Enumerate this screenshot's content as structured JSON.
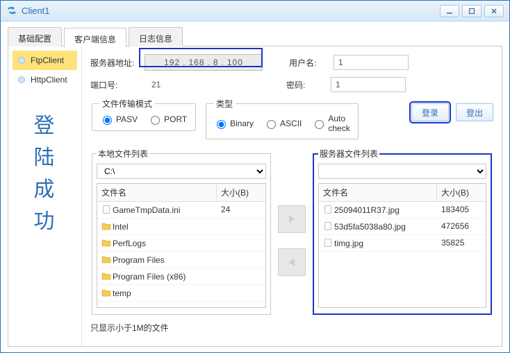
{
  "window": {
    "title": "Client1"
  },
  "tabs": [
    {
      "label": "基础配置",
      "active": false
    },
    {
      "label": "客户端信息",
      "active": true
    },
    {
      "label": "日志信息",
      "active": false
    }
  ],
  "protocols": [
    {
      "label": "FtpClient",
      "selected": true
    },
    {
      "label": "HttpClient",
      "selected": false
    }
  ],
  "status_text": "登陆成功",
  "form": {
    "server_label": "服务器地址:",
    "server_ip": {
      "a": "192",
      "b": "168",
      "c": "8",
      "d": "100"
    },
    "user_label": "用户名:",
    "user_value": "1",
    "port_label": "端口号:",
    "port_value": "21",
    "pass_label": "密码:",
    "pass_value": "1"
  },
  "mode_group": {
    "legend": "文件传输模式",
    "options": [
      "PASV",
      "PORT"
    ],
    "selected": "PASV"
  },
  "type_group": {
    "legend": "类型",
    "options": [
      "Binary",
      "ASCII",
      "Auto check"
    ],
    "selected": "Binary"
  },
  "buttons": {
    "login": "登录",
    "logout": "登出"
  },
  "local_list": {
    "legend": "本地文件列表",
    "path": "C:\\",
    "headers": {
      "name": "文件名",
      "size": "大小(B)"
    },
    "rows": [
      {
        "icon": "file",
        "name": "GameTmpData.ini",
        "size": "24"
      },
      {
        "icon": "folder",
        "name": "Intel",
        "size": ""
      },
      {
        "icon": "folder",
        "name": "PerfLogs",
        "size": ""
      },
      {
        "icon": "folder",
        "name": "Program Files",
        "size": ""
      },
      {
        "icon": "folder",
        "name": "Program Files (x86)",
        "size": ""
      },
      {
        "icon": "folder",
        "name": "temp",
        "size": ""
      }
    ]
  },
  "server_list": {
    "legend": "服务器文件列表",
    "path": "",
    "headers": {
      "name": "文件名",
      "size": "大小(B)"
    },
    "rows": [
      {
        "icon": "file",
        "name": "25094011R37.jpg",
        "size": "183405"
      },
      {
        "icon": "file",
        "name": "53d5fa5038a80.jpg",
        "size": "472656"
      },
      {
        "icon": "file",
        "name": "timg.jpg",
        "size": "35825"
      }
    ]
  },
  "footer_note": "只显示小于1M的文件"
}
